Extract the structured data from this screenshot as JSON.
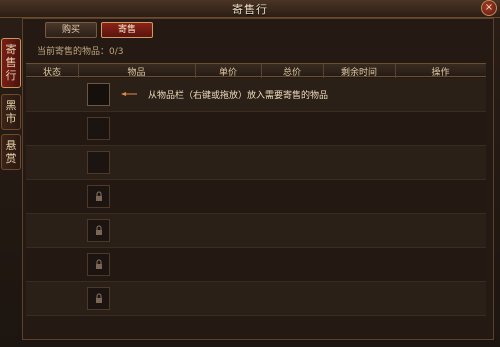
{
  "window": {
    "title": "寄售行",
    "close_label": "×"
  },
  "side_tabs": [
    {
      "label": [
        "寄",
        "售",
        "行"
      ],
      "active": true
    },
    {
      "label": [
        "黑",
        "市"
      ],
      "active": false
    },
    {
      "label": [
        "悬",
        "赏"
      ],
      "active": false
    }
  ],
  "tabs": [
    {
      "label": "购买",
      "active": false
    },
    {
      "label": "寄售",
      "active": true
    }
  ],
  "status": {
    "label": "当前寄售的物品：0/3"
  },
  "table": {
    "columns": [
      "状态",
      "物品",
      "单价",
      "总价",
      "剩余时间",
      "操作"
    ]
  },
  "hint": {
    "text": "从物品栏（右键或拖放）放入需要寄售的物品"
  },
  "slots": [
    {
      "state": "empty"
    },
    {
      "state": "empty"
    },
    {
      "state": "empty"
    },
    {
      "state": "locked"
    },
    {
      "state": "locked"
    },
    {
      "state": "locked"
    },
    {
      "state": "locked"
    }
  ],
  "colors": {
    "active_tab": "#8a2318",
    "accent_border": "#d09a5f",
    "arrow": "#e08a4a"
  }
}
